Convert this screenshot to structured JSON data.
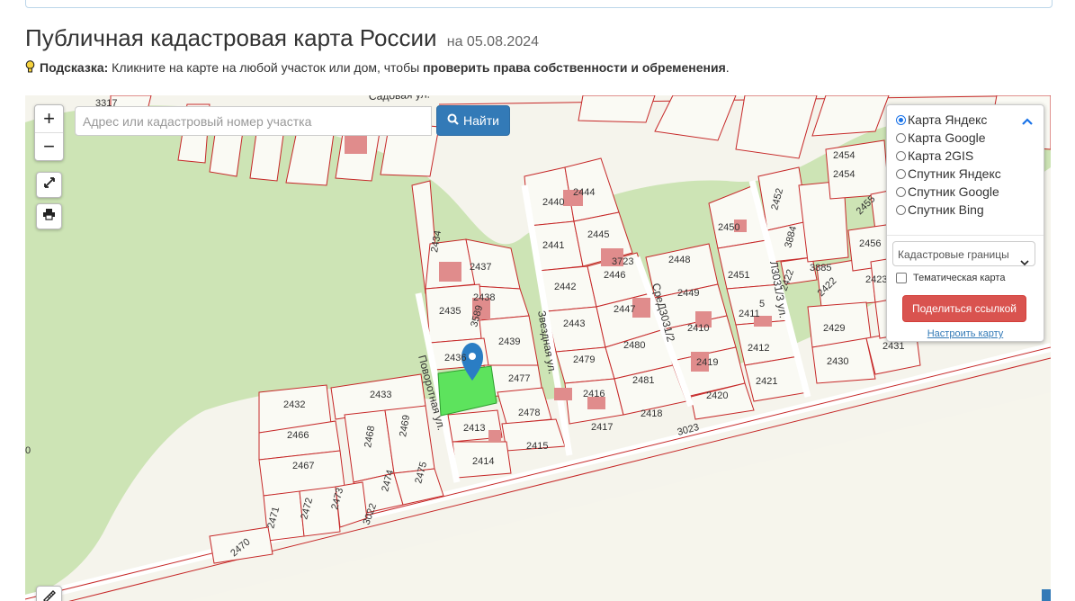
{
  "page": {
    "title": "Публичная кадастровая карта России",
    "date": "на 05.08.2024",
    "hint_label": "Подсказка:",
    "hint_text": " Кликните на карте на любой участок или дом, чтобы ",
    "hint_bold": "проверить права собственности и обременения",
    "hint_end": "."
  },
  "map": {
    "zoom_in": "+",
    "zoom_out": "−",
    "search_placeholder": "Адрес или кадастровый номер участка",
    "search_button": "Найти",
    "street_labels": {
      "povorotnaya": "Поворотная ул.",
      "zvezdnaya": "Звездная ул.",
      "sadovaya": "Садовая ул.",
      "road_3023": "3023",
      "road_3022": "3022",
      "street_3031_2": "СреД3031/2",
      "street_3031_3": "Л3031/3 ул."
    },
    "parcels": [
      "3317",
      "2434",
      "2437",
      "2438",
      "2435",
      "3589",
      "2439",
      "2436",
      "2477",
      "2478",
      "2413",
      "2415",
      "2414",
      "2432",
      "2433",
      "2466",
      "2467",
      "2468",
      "2469",
      "2474",
      "2475",
      "2471",
      "2472",
      "2473",
      "2470",
      "2440",
      "2444",
      "2441",
      "2445",
      "2442",
      "2446",
      "3723",
      "2443",
      "2447",
      "2479",
      "2480",
      "2416",
      "2481",
      "2417",
      "2418",
      "2448",
      "2449",
      "2410",
      "2419",
      "2420",
      "2450",
      "2451",
      "2411",
      "2412",
      "2421",
      "2452",
      "3884",
      "3885",
      "2422",
      "2454",
      "2455",
      "2456",
      "2423",
      "2429",
      "2430",
      "2431",
      "5",
      "0"
    ],
    "colors": {
      "boundary": "#c62828",
      "forest": "#cce3b4",
      "selected": "#5de35d",
      "marker": "#2a7dc4",
      "building": "#e08c8c"
    }
  },
  "layer_panel": {
    "options": [
      "Карта Яндекс",
      "Карта Google",
      "Карта 2GIS",
      "Спутник Яндекс",
      "Спутник Google",
      "Спутник Bing"
    ],
    "selected": "Карта Яндекс",
    "layer_select": "Кадастровые границы",
    "thematic_label": "Тематическая карта",
    "share_button": "Поделиться ссылкой",
    "setup_link": "Настроить карту"
  }
}
